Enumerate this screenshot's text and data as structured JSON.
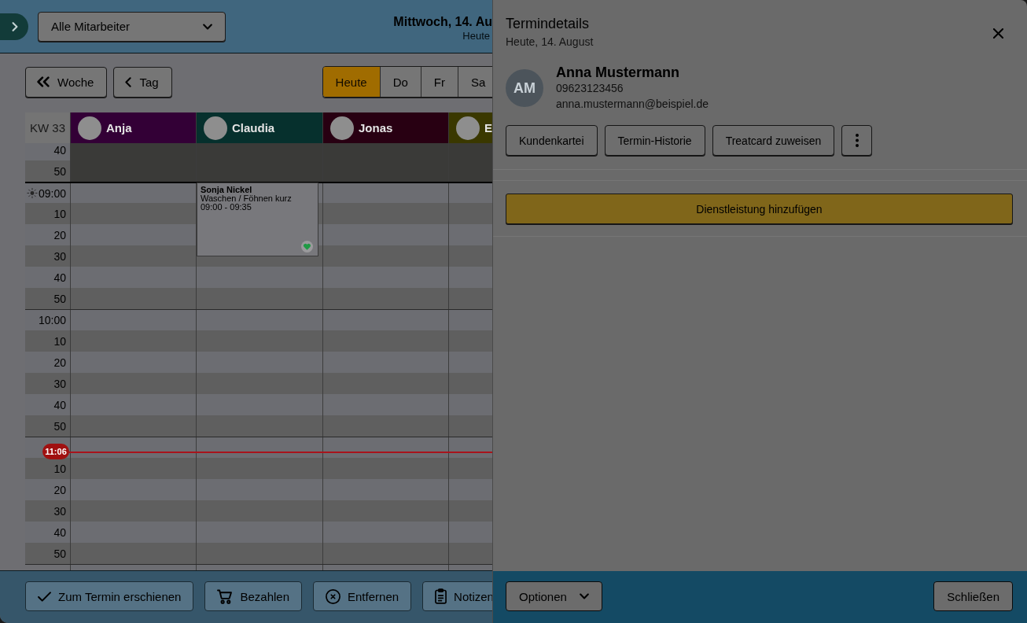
{
  "header": {
    "staff_filter": "Alle Mitarbeiter",
    "date_title": "Mittwoch, 14. Au",
    "date_subtitle": "Heute"
  },
  "toolbar": {
    "nav_buttons": [
      {
        "label": "Woche",
        "kind": "week"
      },
      {
        "label": "Tag",
        "kind": "day"
      }
    ],
    "day_tabs": [
      {
        "label": "Heute",
        "selected": true
      },
      {
        "label": "Do",
        "selected": false
      },
      {
        "label": "Fr",
        "selected": false
      },
      {
        "label": "Sa",
        "selected": false
      }
    ]
  },
  "calendar": {
    "week_label": "KW 33",
    "staff": [
      {
        "name": "Anja",
        "color": "#330036"
      },
      {
        "name": "Claudia",
        "color": "#06302d"
      },
      {
        "name": "Jonas",
        "color": "#280012"
      },
      {
        "name": "E",
        "color": "#3a3800"
      }
    ],
    "time_slots": [
      {
        "label": "40",
        "kind": "minute",
        "closed": true
      },
      {
        "label": "50",
        "kind": "minute",
        "closed": true
      },
      {
        "label": "09:00",
        "kind": "opening",
        "closed": false,
        "cells": [
          {
            "kind": "empty"
          },
          {
            "kind": "booking",
            "client": "Sonja Nickel",
            "service": "Waschen / Föhnen kurz",
            "time": "09:00 - 09:35"
          },
          {
            "kind": "empty"
          },
          {
            "kind": "empty"
          }
        ]
      },
      {
        "label": "10",
        "kind": "minute",
        "closed": false
      },
      {
        "label": "20",
        "kind": "minute",
        "closed": false
      },
      {
        "label": "30",
        "kind": "minute",
        "closed": false
      },
      {
        "label": "40",
        "kind": "minute",
        "closed": false
      },
      {
        "label": "50",
        "kind": "minute",
        "closed": false
      },
      {
        "label": "10:00",
        "kind": "hour",
        "closed": false
      },
      {
        "label": "10",
        "kind": "minute",
        "closed": false
      },
      {
        "label": "20",
        "kind": "minute",
        "closed": false
      },
      {
        "label": "30",
        "kind": "minute",
        "closed": false
      },
      {
        "label": "40",
        "kind": "minute",
        "closed": false
      },
      {
        "label": "50",
        "kind": "minute",
        "closed": false
      },
      {
        "kind": "hour",
        "closed": false,
        "now_marker": "11:06"
      },
      {
        "label": "10",
        "kind": "minute",
        "closed": false
      },
      {
        "label": "20",
        "kind": "minute",
        "closed": false
      },
      {
        "label": "30",
        "kind": "minute",
        "closed": false
      },
      {
        "label": "40",
        "kind": "minute",
        "closed": false
      },
      {
        "label": "50",
        "kind": "minute",
        "closed": false
      },
      {
        "kind": "hour",
        "closed": false
      }
    ]
  },
  "appointment_actions": [
    {
      "label": "Zum Termin erschienen",
      "kind": "check"
    },
    {
      "label": "Bezahlen",
      "kind": "pay"
    },
    {
      "label": "Entfernen",
      "kind": "remove"
    },
    {
      "label": "Notizen",
      "kind": "notes"
    }
  ],
  "details_panel": {
    "title": "Termindetails",
    "subtitle": "Heute, 14. August",
    "customer": {
      "initials": "AM",
      "name": "Anna Mustermann",
      "phone": "09623123456",
      "email": "anna.mustermann@beispiel.de"
    },
    "actions": [
      "Kundenkartei",
      "Termin-Historie",
      "Treatcard zuweisen"
    ],
    "add_service": "Dienstleistung hinzufügen",
    "footer": {
      "options": "Optionen",
      "close": "Schließen"
    }
  }
}
